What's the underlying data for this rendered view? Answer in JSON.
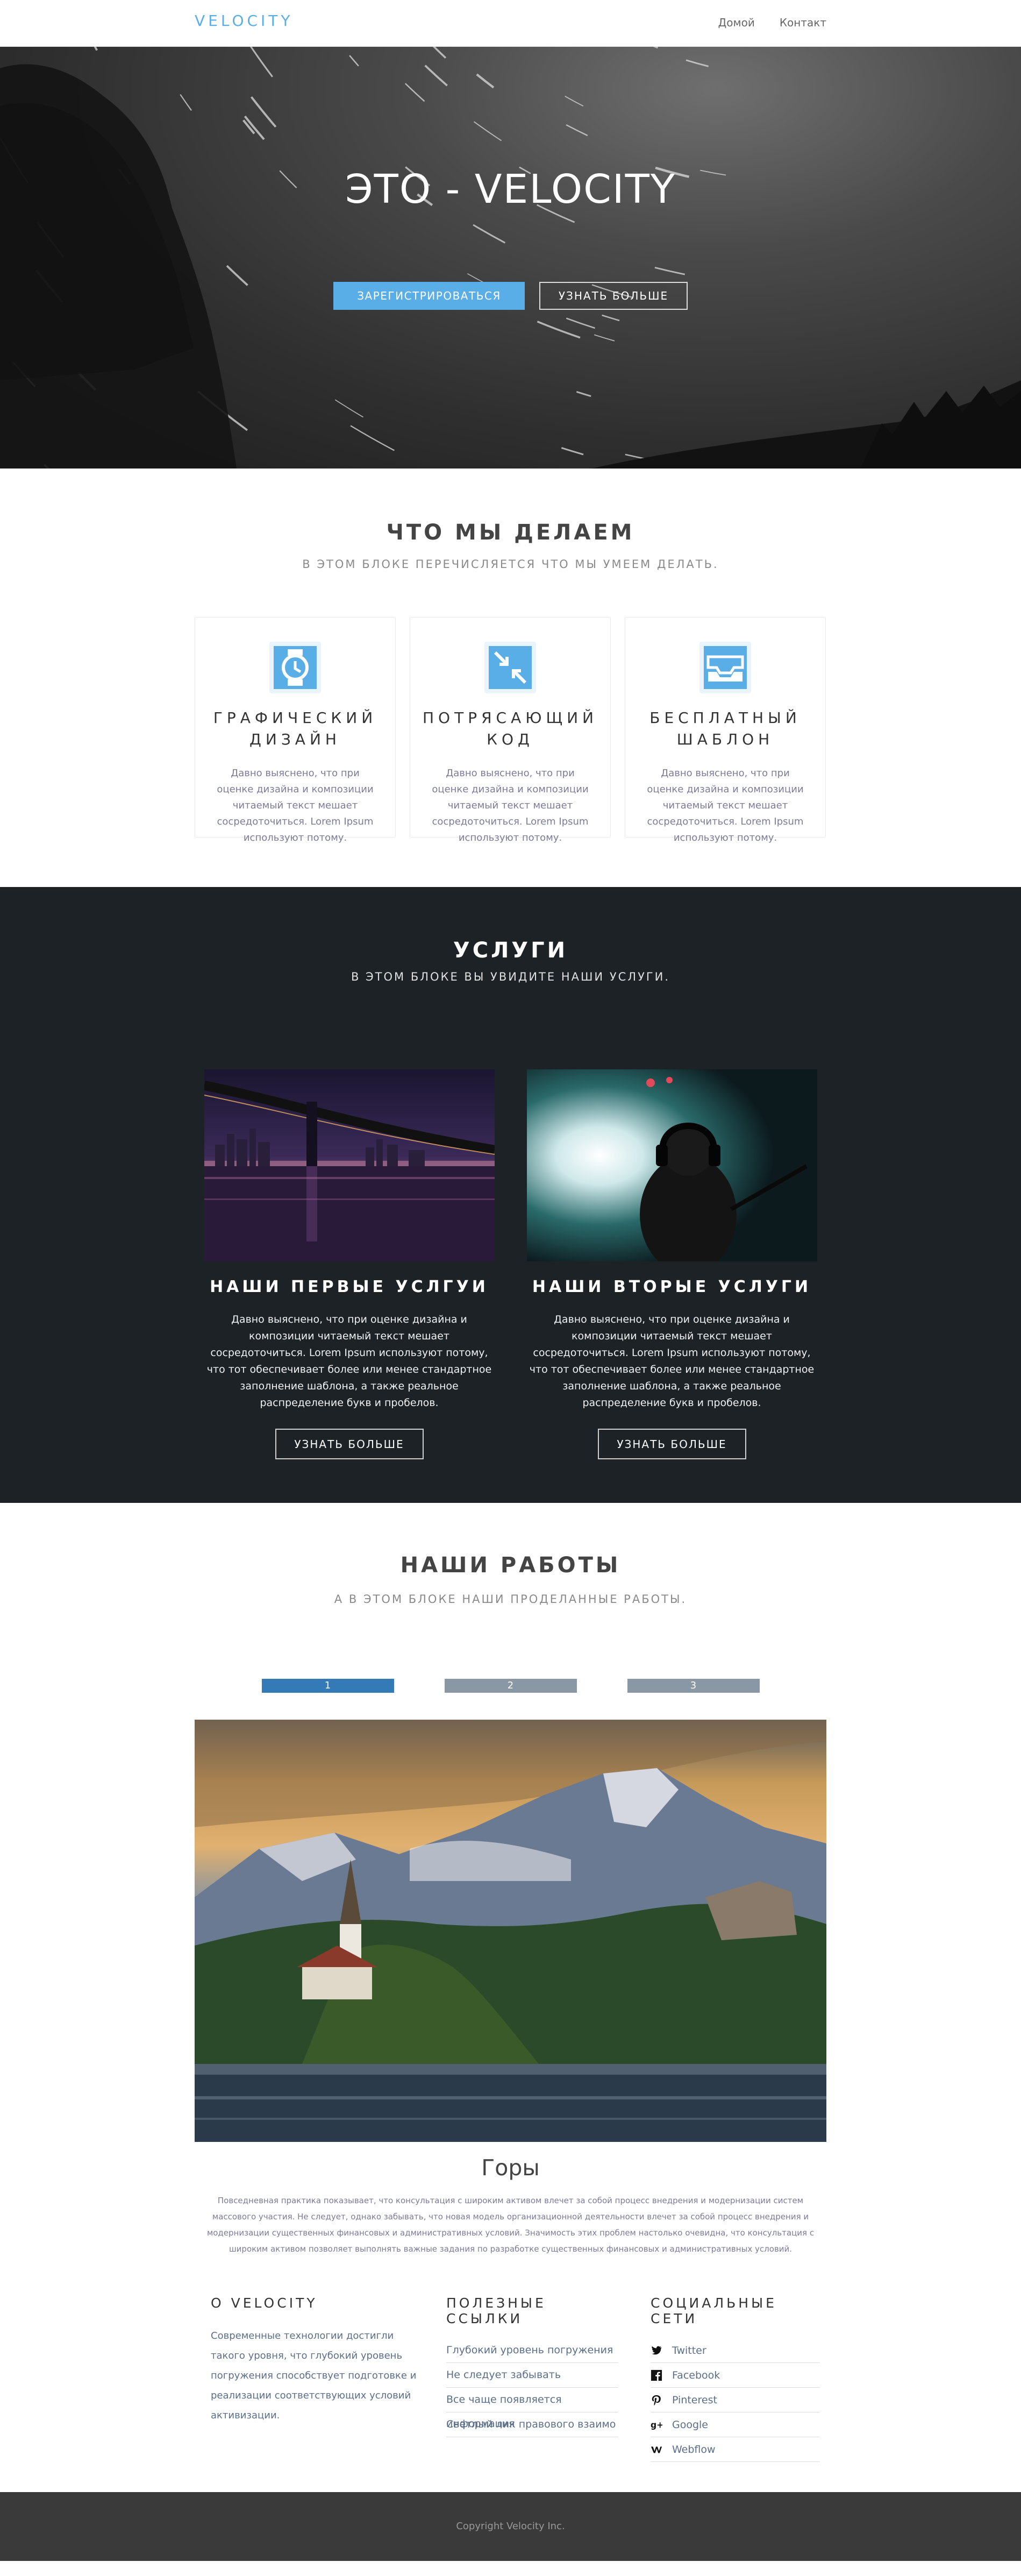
{
  "nav": {
    "brand": "VELOCITY",
    "links": [
      "Домой",
      "Контакт"
    ]
  },
  "hero": {
    "title": "ЭТО - VELOCITY",
    "primary_button": "ЗАРЕГИСТРИРОВАТЬСЯ",
    "secondary_button": "УЗНАТЬ БОЛЬШЕ"
  },
  "what": {
    "title": "ЧТО МЫ ДЕЛАЕМ",
    "subtitle": "В ЭТОМ БЛОКЕ ПЕРЕЧИСЛЯЕТСЯ ЧТО МЫ УМЕЕМ ДЕЛАТЬ.",
    "cards": [
      {
        "icon": "watch-icon",
        "title": "ГРАФИЧЕСКИЙ ДИЗАЙН",
        "text": "Давно выяснено, что при оценке дизайна и композиции читаемый текст мешает сосредоточиться. Lorem Ipsum используют потому."
      },
      {
        "icon": "compress-arrows-icon",
        "title": "ПОТРЯСАЮЩИЙ КОД",
        "text": "Давно выяснено, что при оценке дизайна и композиции читаемый текст мешает сосредоточиться. Lorem Ipsum используют потому."
      },
      {
        "icon": "inbox-icon",
        "title": "БЕСПЛАТНЫЙ ШАБЛОН",
        "text": "Давно выяснено, что при оценке дизайна и композиции читаемый текст мешает сосредоточиться. Lorem Ipsum используют потому."
      }
    ],
    "icon_color": "#5aaee8"
  },
  "services": {
    "title": "УСЛУГИ",
    "subtitle": "В ЭТОМ БЛОКЕ ВЫ УВИДИТЕ НАШИ УСЛУГИ.",
    "items": [
      {
        "title": "НАШИ ПЕРВЫЕ УСЛГУИ",
        "text": "Давно выяснено, что при оценке дизайна и композиции читаемый текст мешает сосредоточиться. Lorem Ipsum используют потому, что тот обеспечивает более или менее стандартное заполнение шаблона, а также реальное распределение букв и пробелов.",
        "button": "УЗНАТЬ БОЛЬШЕ"
      },
      {
        "title": "НАШИ ВТОРЫЕ УСЛУГИ",
        "text": "Давно выяснено, что при оценке дизайна и композиции читаемый текст мешает сосредоточиться. Lorem Ipsum используют потому, что тот обеспечивает более или менее стандартное заполнение шаблона, а также реальное распределение букв и пробелов.",
        "button": "УЗНАТЬ БОЛЬШЕ"
      }
    ]
  },
  "works": {
    "title": "НАШИ РАБОТЫ",
    "subtitle": "А В ЭТОМ БЛОКЕ НАШИ ПРОДЕЛАННЫЕ РАБОТЫ.",
    "tabs": [
      "1",
      "2",
      "3"
    ],
    "active_tab": "1",
    "slide_title": "Горы",
    "slide_text": "Повседневная практика показывает, что консультация с широким активом влечет за собой процесс внедрения и модернизации систем массового участия. Не следует, однако забывать, что новая модель организационной деятельности влечет за собой процесс внедрения и модернизации существенных финансовых и административных условий. Значимость этих проблем настолько очевидна, что консультация с широким активом позволяет выполнять важные задания по разработке существенных финансовых и административных условий."
  },
  "footer": {
    "about_title": "О VELOCITY",
    "about_text": "Современные технологии достигли такого уровня, что глубокий уровень погружения способствует подготовке и реализации соответствующих условий активизации.",
    "links_title": "ПОЛЕЗНЫЕ ССЫЛКИ",
    "links": [
      "Глубокий уровень погружения",
      "Не следует забывать",
      "Все чаще появляется информация",
      "Светлый лик правового взаимо"
    ],
    "social_title": "СОЦИАЛЬНЫЕ СЕТИ",
    "social": [
      {
        "icon": "twitter-icon",
        "label": "Twitter"
      },
      {
        "icon": "facebook-icon",
        "label": "Facebook"
      },
      {
        "icon": "pinterest-icon",
        "label": "Pinterest"
      },
      {
        "icon": "google-plus-icon",
        "label": "Google"
      },
      {
        "icon": "webflow-icon",
        "label": "Webflow"
      }
    ],
    "copyright": "Copyright Velocity Inc."
  }
}
